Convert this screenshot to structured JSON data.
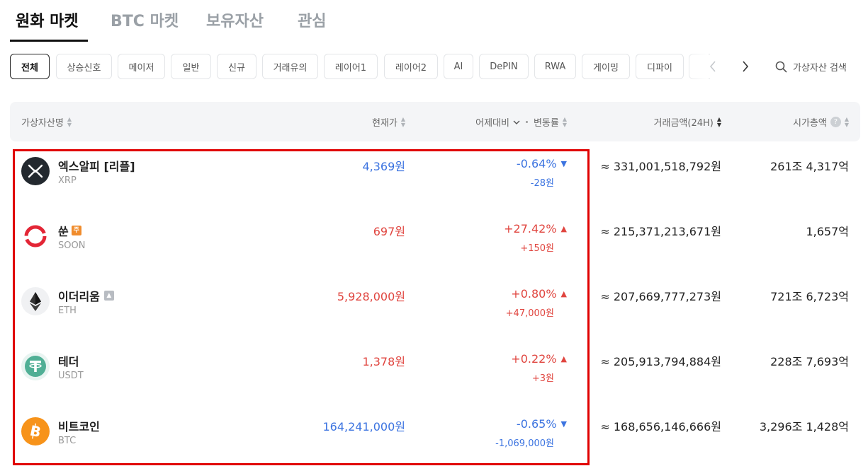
{
  "tabs": [
    {
      "label": "원화 마켓"
    },
    {
      "label": "BTC 마켓"
    },
    {
      "label": "보유자산"
    },
    {
      "label": "관심"
    }
  ],
  "filters": [
    {
      "label": "전체"
    },
    {
      "label": "상승신호"
    },
    {
      "label": "메이저"
    },
    {
      "label": "일반"
    },
    {
      "label": "신규"
    },
    {
      "label": "거래유의"
    },
    {
      "label": "레이어1"
    },
    {
      "label": "레이어2"
    },
    {
      "label": "AI"
    },
    {
      "label": "DePIN"
    },
    {
      "label": "RWA"
    },
    {
      "label": "게이밍"
    },
    {
      "label": "디파이"
    }
  ],
  "search": {
    "label": "가상자산 검색",
    "icon": "search-icon"
  },
  "header": {
    "name": "가상자산명",
    "price": "현재가",
    "change_basis": "어제대비",
    "change_rate": "변동률",
    "volume": "거래금액(24H)",
    "market_cap": "시가총액",
    "help": "?"
  },
  "colors": {
    "up": "#e0453f",
    "down": "#3b73e0",
    "highlight": "#e00000"
  },
  "rows": [
    {
      "name": "엑스알피 [리플]",
      "symbol": "XRP",
      "price": "4,369원",
      "change_rate": "-0.64%",
      "change_amount": "-28원",
      "direction": "down",
      "volume": "≈ 331,001,518,792원",
      "market_cap": "261조 4,317억",
      "icon": "xrp-icon",
      "badge": ""
    },
    {
      "name": "쑨",
      "symbol": "SOON",
      "price": "697원",
      "change_rate": "+27.42%",
      "change_amount": "+150원",
      "direction": "up",
      "volume": "≈ 215,371,213,671원",
      "market_cap": "1,657억",
      "icon": "soon-icon",
      "badge": "주"
    },
    {
      "name": "이더리움",
      "symbol": "ETH",
      "price": "5,928,000원",
      "change_rate": "+0.80%",
      "change_amount": "+47,000원",
      "direction": "up",
      "volume": "≈ 207,669,777,273원",
      "market_cap": "721조 6,723억",
      "icon": "eth-icon",
      "badge": "warn"
    },
    {
      "name": "테더",
      "symbol": "USDT",
      "price": "1,378원",
      "change_rate": "+0.22%",
      "change_amount": "+3원",
      "direction": "up",
      "volume": "≈ 205,913,794,884원",
      "market_cap": "228조 7,693억",
      "icon": "usdt-icon",
      "badge": ""
    },
    {
      "name": "비트코인",
      "symbol": "BTC",
      "price": "164,241,000원",
      "change_rate": "-0.65%",
      "change_amount": "-1,069,000원",
      "direction": "down",
      "volume": "≈ 168,656,146,666원",
      "market_cap": "3,296조 1,428억",
      "icon": "btc-icon",
      "badge": ""
    }
  ]
}
